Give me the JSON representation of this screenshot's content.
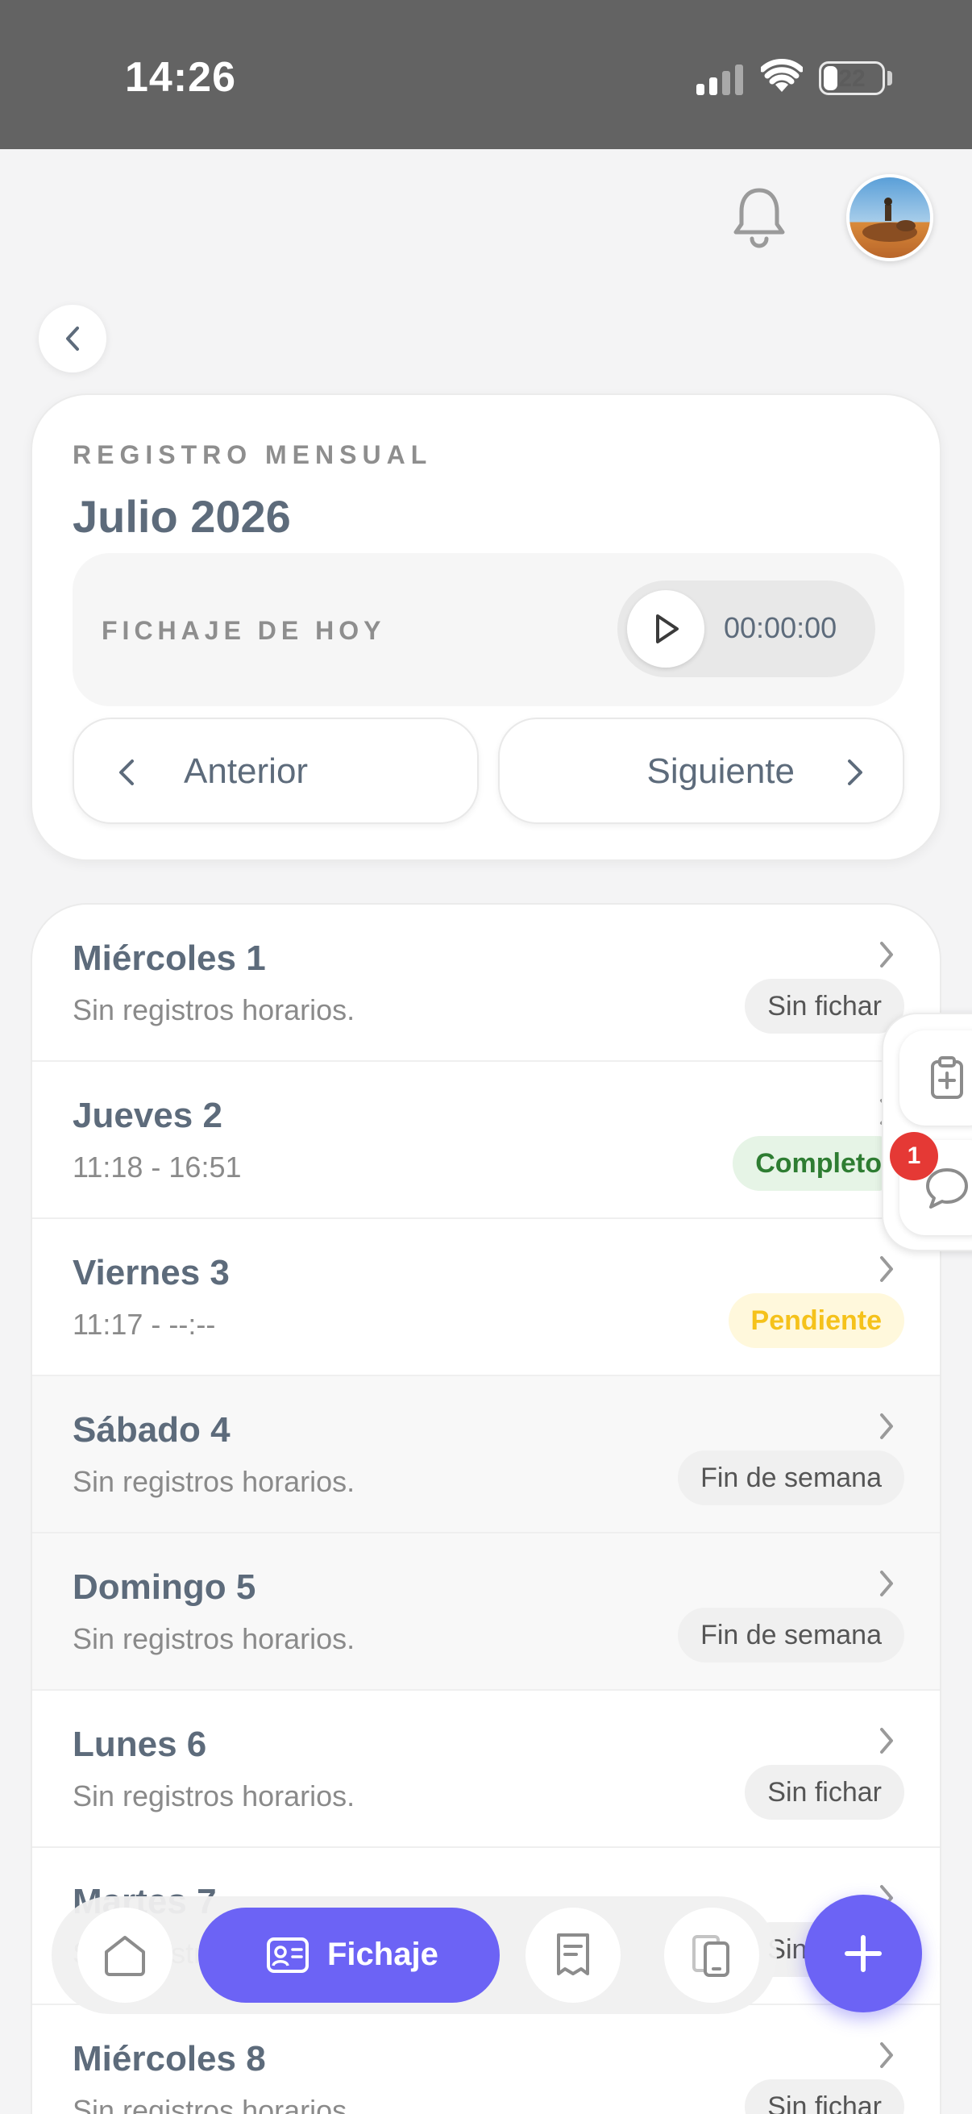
{
  "status_bar": {
    "time": "14:26",
    "battery": "22"
  },
  "header": {
    "bell_icon": "bell-icon",
    "avatar": "user-avatar",
    "back_icon": "chevron-left-icon"
  },
  "month_card": {
    "label": "REGISTRO MENSUAL",
    "title": "Julio 2026",
    "today_label": "FICHAJE DE HOY",
    "timer": "00:00:00",
    "prev_label": "Anterior",
    "next_label": "Siguiente"
  },
  "days": [
    {
      "name": "Miércoles 1",
      "sub": "Sin registros horarios.",
      "badge": "Sin fichar",
      "status": "gray"
    },
    {
      "name": "Jueves 2",
      "sub": "11:18 - 16:51",
      "badge": "Completo",
      "status": "green"
    },
    {
      "name": "Viernes 3",
      "sub": "11:17 - --:--",
      "badge": "Pendiente",
      "status": "yellow"
    },
    {
      "name": "Sábado 4",
      "sub": "Sin registros horarios.",
      "badge": "Fin de semana",
      "status": "gray"
    },
    {
      "name": "Domingo 5",
      "sub": "Sin registros horarios.",
      "badge": "Fin de semana",
      "status": "gray"
    },
    {
      "name": "Lunes 6",
      "sub": "Sin registros horarios.",
      "badge": "Sin fichar",
      "status": "gray"
    },
    {
      "name": "Martes 7",
      "sub": "Sin registros horarios.",
      "badge": "Sin fichar",
      "status": "gray"
    },
    {
      "name": "Miércoles 8",
      "sub": "Sin registros horarios.",
      "badge": "Sin fichar",
      "status": "gray"
    }
  ],
  "side_widget": {
    "notification_count": "1"
  },
  "bottom_nav": {
    "active_label": "Fichaje"
  },
  "colors": {
    "accent": "#6c63f5",
    "text": "#5d6b7b",
    "complete": "#2e7d32",
    "pending": "#f5c21b",
    "alert": "#e53935"
  }
}
